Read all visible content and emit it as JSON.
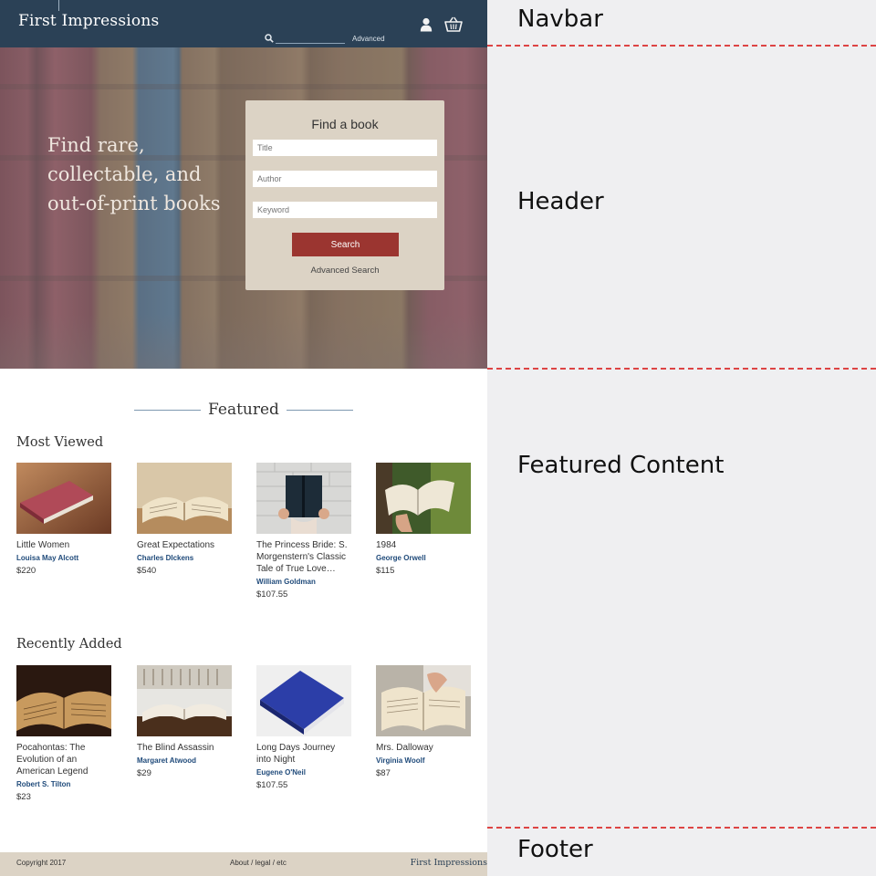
{
  "navbar": {
    "brand": "First Impressions",
    "search_placeholder": "",
    "advanced_link": "Advanced",
    "icons": [
      "search-icon",
      "user-icon",
      "cart-icon"
    ],
    "color": "#2b4156"
  },
  "header": {
    "tagline": "Find rare, collectable, and out-of-print books",
    "find_box": {
      "title": "Find a book",
      "title_placeholder": "Title",
      "author_placeholder": "Author",
      "keyword_placeholder": "Keyword",
      "search_button": "Search",
      "advanced_link": "Advanced Search"
    },
    "button_color": "#9b3530",
    "box_color": "#dcd3c5"
  },
  "featured": {
    "title": "Featured",
    "most_viewed": {
      "heading": "Most Viewed",
      "books": [
        {
          "title": "Little Women",
          "author": "Louisa May Alcott",
          "price": "$220"
        },
        {
          "title": "Great Expectations",
          "author": "Charles DIckens",
          "price": "$540"
        },
        {
          "title": "The Princess Bride: S. Morgenstern's Classic Tale of True Love…",
          "author": "William Goldman",
          "price": "$107.55"
        },
        {
          "title": "1984",
          "author": "George Orwell",
          "price": "$115"
        }
      ]
    },
    "recently_added": {
      "heading": "Recently Added",
      "books": [
        {
          "title": "Pocahontas: The Evolution of an American Legend",
          "author": "Robert S. Tilton",
          "price": "$23"
        },
        {
          "title": "The Blind Assassin",
          "author": "Margaret Atwood",
          "price": "$29"
        },
        {
          "title": "Long Days Journey into Night",
          "author": "Eugene O'Neil",
          "price": "$107.55"
        },
        {
          "title": "Mrs. Dalloway",
          "author": "Virginia Woolf",
          "price": "$87"
        }
      ]
    },
    "author_color": "#1f4a7a"
  },
  "footer": {
    "copyright": "Copyright 2017",
    "links": "About / legal / etc",
    "brand": "First Impressions"
  },
  "annotations": {
    "navbar": "Navbar",
    "header": "Header",
    "featured": "Featured Content",
    "footer": "Footer",
    "divider_color": "#dd4444"
  }
}
